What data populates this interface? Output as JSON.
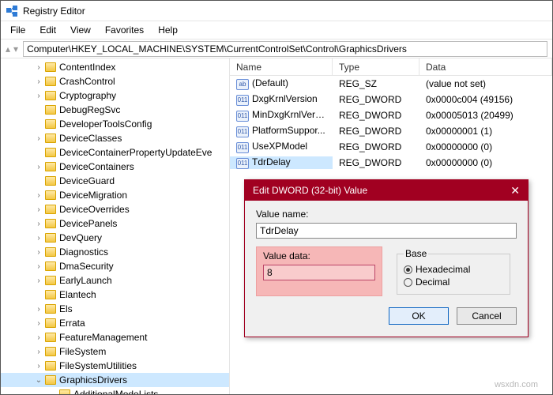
{
  "title": "Registry Editor",
  "menu": [
    "File",
    "Edit",
    "View",
    "Favorites",
    "Help"
  ],
  "address": "Computer\\HKEY_LOCAL_MACHINE\\SYSTEM\\CurrentControlSet\\Control\\GraphicsDrivers",
  "tree": [
    {
      "label": "ContentIndex",
      "tw": ">"
    },
    {
      "label": "CrashControl",
      "tw": ">"
    },
    {
      "label": "Cryptography",
      "tw": ">"
    },
    {
      "label": "DebugRegSvc",
      "tw": ""
    },
    {
      "label": "DeveloperToolsConfig",
      "tw": ""
    },
    {
      "label": "DeviceClasses",
      "tw": ">"
    },
    {
      "label": "DeviceContainerPropertyUpdateEve",
      "tw": ""
    },
    {
      "label": "DeviceContainers",
      "tw": ">"
    },
    {
      "label": "DeviceGuard",
      "tw": ""
    },
    {
      "label": "DeviceMigration",
      "tw": ">"
    },
    {
      "label": "DeviceOverrides",
      "tw": ">"
    },
    {
      "label": "DevicePanels",
      "tw": ">"
    },
    {
      "label": "DevQuery",
      "tw": ">"
    },
    {
      "label": "Diagnostics",
      "tw": ">"
    },
    {
      "label": "DmaSecurity",
      "tw": ">"
    },
    {
      "label": "EarlyLaunch",
      "tw": ">"
    },
    {
      "label": "Elantech",
      "tw": ""
    },
    {
      "label": "Els",
      "tw": ">"
    },
    {
      "label": "Errata",
      "tw": ">"
    },
    {
      "label": "FeatureManagement",
      "tw": ">"
    },
    {
      "label": "FileSystem",
      "tw": ">"
    },
    {
      "label": "FileSystemUtilities",
      "tw": ">"
    },
    {
      "label": "GraphicsDrivers",
      "tw": "v",
      "sel": true
    },
    {
      "label": "AdditionalModeLists",
      "tw": "",
      "child": true
    }
  ],
  "cols": {
    "name": "Name",
    "type": "Type",
    "data": "Data"
  },
  "values": [
    {
      "icon": "sz",
      "name": "(Default)",
      "type": "REG_SZ",
      "data": "(value not set)"
    },
    {
      "icon": "dw",
      "name": "DxgKrnlVersion",
      "type": "REG_DWORD",
      "data": "0x0000c004 (49156)"
    },
    {
      "icon": "dw",
      "name": "MinDxgKrnlVersi...",
      "type": "REG_DWORD",
      "data": "0x00005013 (20499)"
    },
    {
      "icon": "dw",
      "name": "PlatformSuppor...",
      "type": "REG_DWORD",
      "data": "0x00000001 (1)"
    },
    {
      "icon": "dw",
      "name": "UseXPModel",
      "type": "REG_DWORD",
      "data": "0x00000000 (0)"
    },
    {
      "icon": "dw",
      "name": "TdrDelay",
      "type": "REG_DWORD",
      "data": "0x00000000 (0)",
      "sel": true
    }
  ],
  "dialog": {
    "title": "Edit DWORD (32-bit) Value",
    "value_name_label": "Value name:",
    "value_name": "TdrDelay",
    "value_data_label": "Value data:",
    "value_data": "8",
    "base_label": "Base",
    "hex": "Hexadecimal",
    "dec": "Decimal",
    "ok": "OK",
    "cancel": "Cancel"
  },
  "watermark": "wsxdn.com"
}
